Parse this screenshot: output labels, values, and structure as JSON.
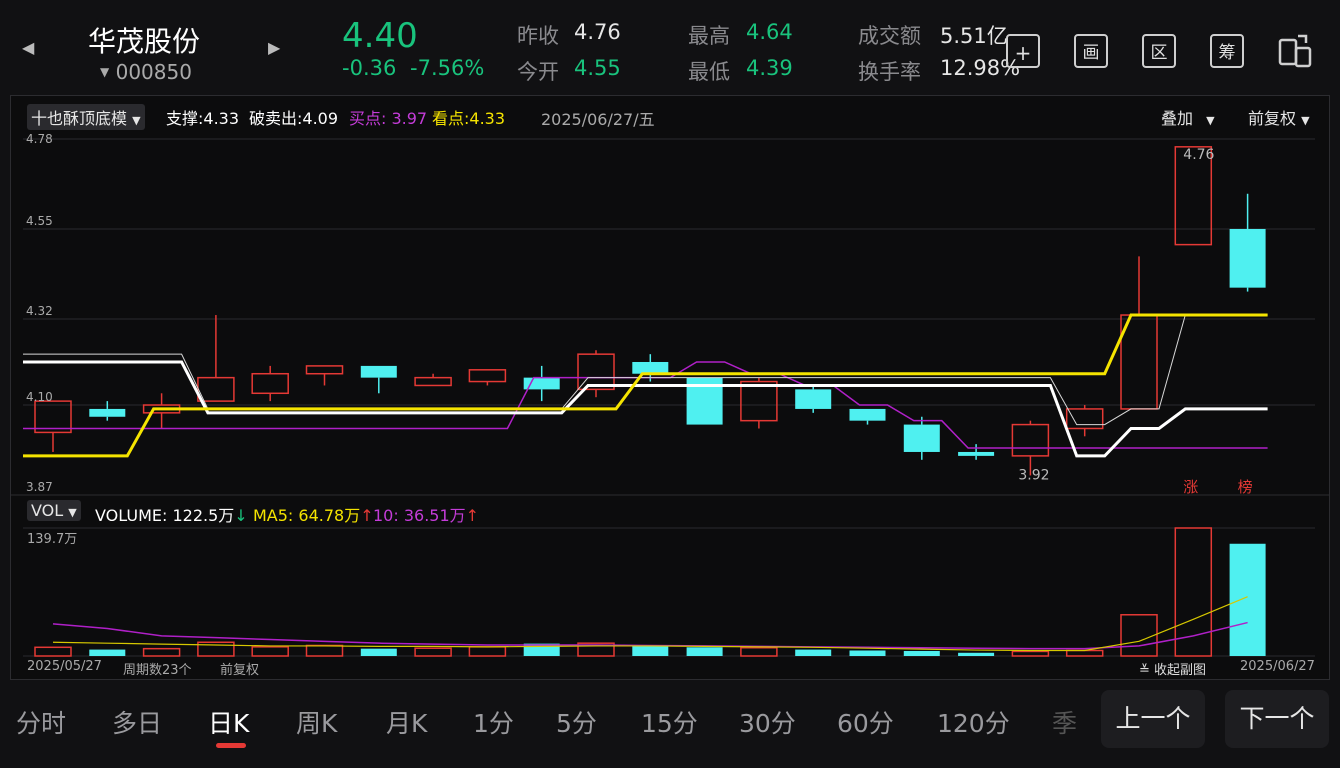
{
  "stock": {
    "name": "华茂股份",
    "code": "000850",
    "price": "4.40",
    "change": "-0.36",
    "change_pct": "-7.56%",
    "prev_close_label": "昨收",
    "prev_close": "4.76",
    "open_label": "今开",
    "open": "4.55",
    "high_label": "最高",
    "high": "4.64",
    "low_label": "最低",
    "low": "4.39",
    "amount_label": "成交额",
    "amount": "5.51亿",
    "turnover_label": "换手率",
    "turnover": "12.98%"
  },
  "toolbar": {
    "add_glyph": "+",
    "draw_glyph": "画",
    "range_glyph": "区",
    "chips_glyph": "筹"
  },
  "colors": {
    "up": "#e53935",
    "down": "#4ff0f0",
    "yellow": "#f5e400",
    "purple": "#b020c8",
    "white": "#ffffff",
    "green": "#19c37d"
  },
  "indicator": {
    "name": "十也酥顶底模",
    "support": "支撑:4.33",
    "breakout": "破卖出:4.09",
    "buy": "买点: 3.97",
    "watch": "看点:4.33",
    "date": "2025/06/27/五",
    "overlay": "叠加",
    "adjust": "前复权"
  },
  "price_axis": {
    "ticks": [
      "4.78",
      "4.55",
      "4.32",
      "4.10",
      "3.87"
    ],
    "max_label": "4.76",
    "min_label": "3.92",
    "tag_up": "涨",
    "tag_rank": "榜"
  },
  "volume_panel": {
    "selector": "VOL",
    "volume": "VOLUME: 122.5万",
    "ma5": "MA5: 64.78万",
    "ma10": "10: 36.51万",
    "down_arrow": "↓",
    "up_arrow": "↑",
    "max_label": "139.7万"
  },
  "footer": {
    "start_date": "2025/05/27",
    "periods": "周期数23个",
    "adjust": "前复权",
    "collapse": "收起副图",
    "collapse_glyph": "≚",
    "end_date": "2025/06/27"
  },
  "tabs": [
    "分时",
    "多日",
    "日K",
    "周K",
    "月K",
    "1分",
    "5分",
    "15分",
    "30分",
    "60分",
    "120分",
    "季"
  ],
  "active_tab": "日K",
  "nav": {
    "prev": "上一个",
    "next": "下一个"
  },
  "chart_data": {
    "type": "candlestick",
    "price_range": [
      3.87,
      4.78
    ],
    "candles": [
      {
        "open": 4.03,
        "close": 4.11,
        "high": 4.11,
        "low": 3.98
      },
      {
        "open": 4.09,
        "close": 4.07,
        "high": 4.11,
        "low": 4.06
      },
      {
        "open": 4.08,
        "close": 4.1,
        "high": 4.13,
        "low": 4.04
      },
      {
        "open": 4.11,
        "close": 4.17,
        "high": 4.33,
        "low": 4.11
      },
      {
        "open": 4.13,
        "close": 4.18,
        "high": 4.2,
        "low": 4.11
      },
      {
        "open": 4.18,
        "close": 4.2,
        "high": 4.2,
        "low": 4.15
      },
      {
        "open": 4.2,
        "close": 4.17,
        "high": 4.2,
        "low": 4.13
      },
      {
        "open": 4.15,
        "close": 4.17,
        "high": 4.18,
        "low": 4.15
      },
      {
        "open": 4.16,
        "close": 4.19,
        "high": 4.19,
        "low": 4.15
      },
      {
        "open": 4.17,
        "close": 4.14,
        "high": 4.2,
        "low": 4.11
      },
      {
        "open": 4.14,
        "close": 4.23,
        "high": 4.24,
        "low": 4.12
      },
      {
        "open": 4.21,
        "close": 4.18,
        "high": 4.23,
        "low": 4.16
      },
      {
        "open": 4.17,
        "close": 4.05,
        "high": 4.17,
        "low": 4.05
      },
      {
        "open": 4.06,
        "close": 4.16,
        "high": 4.17,
        "low": 4.04
      },
      {
        "open": 4.14,
        "close": 4.09,
        "high": 4.15,
        "low": 4.08
      },
      {
        "open": 4.09,
        "close": 4.06,
        "high": 4.09,
        "low": 4.05
      },
      {
        "open": 4.05,
        "close": 3.98,
        "high": 4.07,
        "low": 3.96
      },
      {
        "open": 3.98,
        "close": 3.97,
        "high": 4.0,
        "low": 3.96
      },
      {
        "open": 3.97,
        "close": 4.05,
        "high": 4.06,
        "low": 3.92
      },
      {
        "open": 4.04,
        "close": 4.09,
        "high": 4.1,
        "low": 4.02
      },
      {
        "open": 4.09,
        "close": 4.33,
        "high": 4.48,
        "low": 4.09
      },
      {
        "open": 4.51,
        "close": 4.76,
        "high": 4.76,
        "low": 4.51
      },
      {
        "open": 4.55,
        "close": 4.4,
        "high": 4.64,
        "low": 4.39
      }
    ],
    "yellow_line": [
      3.97,
      3.97,
      4.09,
      4.09,
      4.09,
      4.09,
      4.09,
      4.09,
      4.09,
      4.09,
      4.09,
      4.18,
      4.18,
      4.18,
      4.18,
      4.18,
      4.18,
      4.18,
      4.18,
      4.18,
      4.33,
      4.33,
      4.33
    ],
    "white_line": [
      4.21,
      4.21,
      4.21,
      4.08,
      4.08,
      4.08,
      4.08,
      4.08,
      4.08,
      4.08,
      4.15,
      4.15,
      4.15,
      4.15,
      4.15,
      4.15,
      4.15,
      4.15,
      4.15,
      3.97,
      4.04,
      4.09,
      4.09
    ],
    "thin_white_line": [
      4.23,
      4.23,
      4.23,
      4.09,
      4.09,
      4.09,
      4.09,
      4.09,
      4.09,
      4.09,
      4.17,
      4.17,
      4.17,
      4.17,
      4.17,
      4.17,
      4.17,
      4.17,
      4.17,
      4.05,
      4.09,
      4.33,
      4.33
    ],
    "purple_line": [
      4.04,
      4.04,
      4.04,
      4.04,
      4.04,
      4.04,
      4.04,
      4.04,
      4.04,
      4.17,
      4.17,
      4.17,
      4.21,
      4.18,
      4.15,
      4.1,
      4.06,
      3.99,
      3.99,
      3.99,
      3.99,
      3.99,
      3.99
    ],
    "volume_max": 139.7,
    "volumes": [
      9.5,
      7.0,
      8.0,
      15.0,
      10.0,
      11.5,
      8.0,
      8.5,
      10.0,
      13.5,
      14.0,
      10.5,
      9.5,
      9.0,
      7.0,
      6.0,
      5.5,
      3.5,
      5.0,
      6.0,
      45.0,
      139.7,
      122.5
    ],
    "vol_ma5": [
      15.0,
      14.0,
      13.0,
      12.0,
      11.0,
      11.0,
      10.5,
      10.5,
      10.0,
      10.5,
      11.0,
      11.0,
      10.5,
      10.0,
      9.5,
      8.5,
      7.5,
      6.5,
      6.0,
      6.0,
      16.0,
      40.0,
      64.78
    ],
    "vol_ma10": [
      35.0,
      30.0,
      22.0,
      20.0,
      18.0,
      16.0,
      14.0,
      13.0,
      12.0,
      12.0,
      12.0,
      11.5,
      11.0,
      10.5,
      10.0,
      9.5,
      9.0,
      8.5,
      8.0,
      8.0,
      11.0,
      22.0,
      36.51
    ]
  }
}
